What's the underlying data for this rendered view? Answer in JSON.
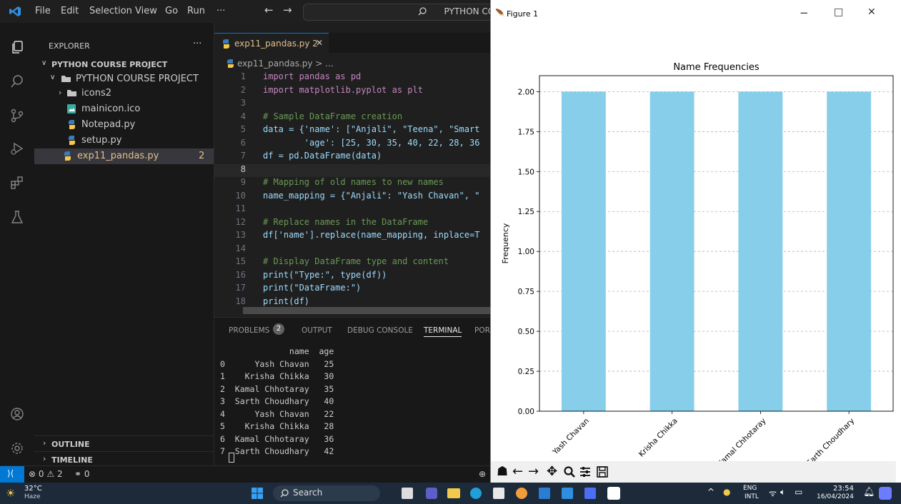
{
  "titlebar": {
    "menus": [
      "File",
      "Edit",
      "Selection",
      "View",
      "Go",
      "Run",
      "···"
    ],
    "search_text": "PYTHON COURS"
  },
  "sidebar": {
    "title": "EXPLORER",
    "more": "···",
    "root": "PYTHON COURSE PROJECT",
    "items": [
      {
        "label": "PYTHON COURSE PROJECT",
        "kind": "folder-open"
      },
      {
        "label": "icons2",
        "kind": "folder"
      },
      {
        "label": "mainicon.ico",
        "kind": "image"
      },
      {
        "label": "Notepad.py",
        "kind": "python"
      },
      {
        "label": "setup.py",
        "kind": "python"
      },
      {
        "label": "exp11_pandas.py",
        "kind": "python",
        "badge": "2"
      }
    ],
    "outline": "OUTLINE",
    "timeline": "TIMELINE"
  },
  "editor": {
    "tab_label": "exp11_pandas.py 2",
    "tab_close": "✕",
    "breadcrumb": "exp11_pandas.py > ...",
    "lines": [
      {
        "n": "1",
        "t": "import pandas as pd"
      },
      {
        "n": "2",
        "t": "import matplotlib.pyplot as plt"
      },
      {
        "n": "3",
        "t": ""
      },
      {
        "n": "4",
        "t": "# Sample DataFrame creation"
      },
      {
        "n": "5",
        "t": "data = {'name': [\"Anjali\", \"Teena\", \"Smart"
      },
      {
        "n": "6",
        "t": "        'age': [25, 30, 35, 40, 22, 28, 36"
      },
      {
        "n": "7",
        "t": "df = pd.DataFrame(data)"
      },
      {
        "n": "8",
        "t": ""
      },
      {
        "n": "9",
        "t": "# Mapping of old names to new names"
      },
      {
        "n": "10",
        "t": "name_mapping = {\"Anjali\": \"Yash Chavan\", \""
      },
      {
        "n": "11",
        "t": ""
      },
      {
        "n": "12",
        "t": "# Replace names in the DataFrame"
      },
      {
        "n": "13",
        "t": "df['name'].replace(name_mapping, inplace=T"
      },
      {
        "n": "14",
        "t": ""
      },
      {
        "n": "15",
        "t": "# Display DataFrame type and content"
      },
      {
        "n": "16",
        "t": "print(\"Type:\", type(df))"
      },
      {
        "n": "17",
        "t": "print(\"DataFrame:\")"
      },
      {
        "n": "18",
        "t": "print(df)"
      }
    ]
  },
  "panel": {
    "tabs": [
      "PROBLEMS",
      "OUTPUT",
      "DEBUG CONSOLE",
      "TERMINAL",
      "POR"
    ],
    "problems_count": "2",
    "terminal": [
      "              name  age",
      "0      Yash Chavan   25",
      "1    Krisha Chikka   30",
      "2  Kamal Chhotaray   35",
      "3  Sarth Choudhary   40",
      "4      Yash Chavan   22",
      "5    Krisha Chikka   28",
      "6  Kamal Chhotaray   36",
      "7  Sarth Choudhary   42"
    ]
  },
  "statusbar": {
    "errors": "0",
    "warnings": "2",
    "ports": "0"
  },
  "figure": {
    "window_title": "Figure 1",
    "controls": [
      "−",
      "□",
      "✕"
    ]
  },
  "chart_data": {
    "type": "bar",
    "title": "Name Frequencies",
    "ylabel": "Frequency",
    "xlabel": "",
    "categories": [
      "Yash Chavan",
      "Krisha Chikka",
      "Kamal Chhotaray",
      "Sarth Choudhary"
    ],
    "values": [
      2,
      2,
      2,
      2
    ],
    "ylim": [
      0,
      2.1
    ],
    "yticks": [
      "0.00",
      "0.25",
      "0.50",
      "0.75",
      "1.00",
      "1.25",
      "1.50",
      "1.75",
      "2.00"
    ],
    "grid": "y dashed",
    "color": "#87ceeb"
  },
  "taskbar": {
    "weather_temp": "32°C",
    "weather_desc": "Haze",
    "search": "Search",
    "lang1": "ENG",
    "lang2": "INTL",
    "time": "23:54",
    "date": "16/04/2024"
  },
  "colors": {
    "accent": "#0078d4",
    "python_icon": "#f2c94c",
    "error_badge": "#e2c08d"
  }
}
